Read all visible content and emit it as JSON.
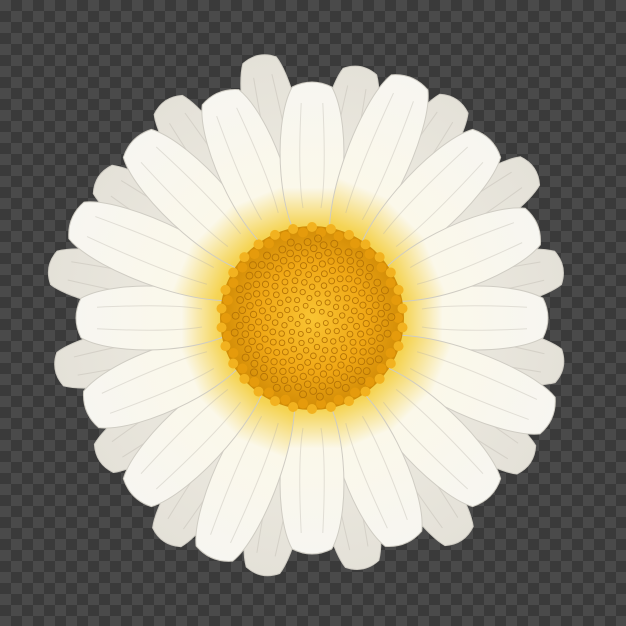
{
  "image": {
    "subject": "daisy-flower",
    "background": "transparency-checkerboard",
    "colors": {
      "checker_dark": "#3a3a3a",
      "checker_light": "#4a4a4a",
      "petal_white": "#f7f6f1",
      "petal_shade": "#d9d7d0",
      "petal_yellow": "#f2c31c",
      "center_light": "#f7bb23",
      "center_dark": "#d08b06",
      "floret_dot": "#b57406"
    }
  }
}
